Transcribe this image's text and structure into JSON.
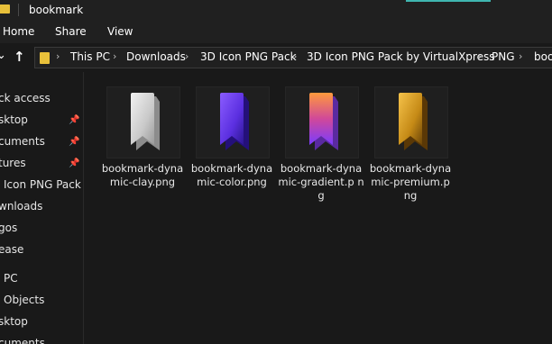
{
  "window": {
    "title": "bookmark",
    "accent_color": "#3fb6b0"
  },
  "ribbon": {
    "tabs": [
      "Home",
      "Share",
      "View"
    ]
  },
  "address_bar": {
    "nav_down_icon": "chevron-down-icon",
    "nav_up_icon": "arrow-up-icon",
    "crumbs": [
      "This PC",
      "Downloads",
      "3D Icon PNG Pack",
      "3D Icon PNG Pack by VirtualXpress",
      "PNG",
      "boo"
    ]
  },
  "sidebar": {
    "items": [
      {
        "label": "ck access",
        "pinned": false
      },
      {
        "label": "sktop",
        "pinned": true
      },
      {
        "label": "cuments",
        "pinned": true
      },
      {
        "label": "tures",
        "pinned": true
      },
      {
        "label": "Icon PNG Pack b",
        "pinned": false
      },
      {
        "label": "wnloads",
        "pinned": false
      },
      {
        "label": "gos",
        "pinned": false
      },
      {
        "label": "ease",
        "pinned": false
      },
      {
        "label": "PC",
        "pinned": false
      },
      {
        "label": "Objects",
        "pinned": false
      },
      {
        "label": "sktop",
        "pinned": false
      },
      {
        "label": "cuments",
        "pinned": false
      }
    ]
  },
  "files": [
    {
      "name": "bookmark-dynamic-clay.png",
      "display": "bookmark-dyna mic-clay.png",
      "icon": "bookmark-clay-icon",
      "colors": [
        "#f2f2f2",
        "#c9c9c9",
        "#9a9a9a"
      ]
    },
    {
      "name": "bookmark-dynamic-color.png",
      "display": "bookmark-dyna mic-color.png",
      "icon": "bookmark-color-icon",
      "colors": [
        "#8a5cff",
        "#5b2fe0",
        "#2c1690"
      ]
    },
    {
      "name": "bookmark-dynamic-gradient.png",
      "display": "bookmark-dyna mic-gradient.p ng",
      "icon": "bookmark-gradient-icon",
      "colors": [
        "#ff9a3c",
        "#d0489a",
        "#7a3cff"
      ]
    },
    {
      "name": "bookmark-dynamic-premium.png",
      "display": "bookmark-dyna mic-premium.p ng",
      "icon": "bookmark-premium-icon",
      "colors": [
        "#f5c24a",
        "#c58a16",
        "#6b4508"
      ]
    }
  ]
}
